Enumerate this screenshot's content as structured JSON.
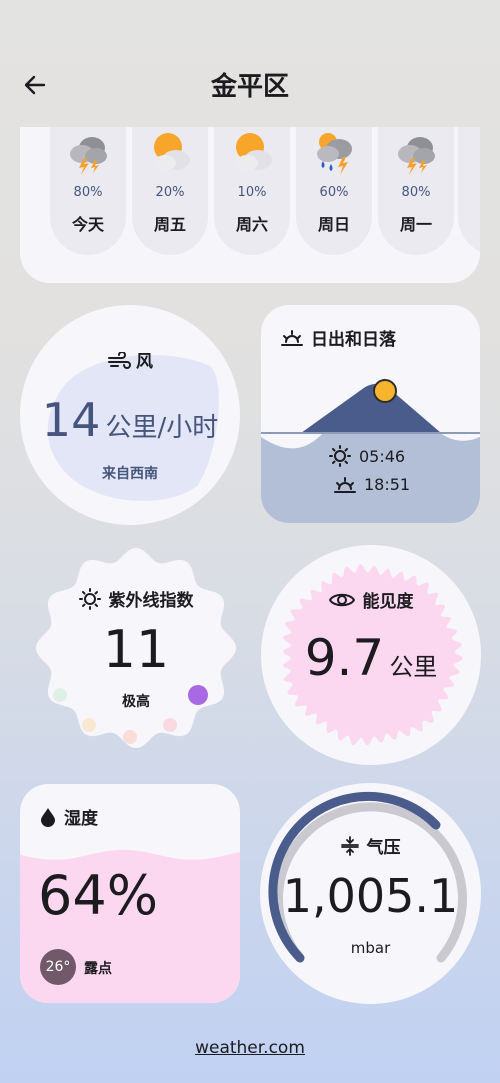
{
  "header": {
    "title": "金平区"
  },
  "forecast": [
    {
      "day": "今天",
      "precip": "80%",
      "icon": "thunderstorm-icon"
    },
    {
      "day": "周五",
      "precip": "20%",
      "icon": "partly-cloudy-icon"
    },
    {
      "day": "周六",
      "precip": "10%",
      "icon": "partly-cloudy-icon"
    },
    {
      "day": "周日",
      "precip": "60%",
      "icon": "rain-thunder-icon"
    },
    {
      "day": "周一",
      "precip": "80%",
      "icon": "thunderstorm-icon"
    }
  ],
  "wind": {
    "label": "风",
    "speed": "14",
    "unit": "公里/小时",
    "direction": "来自西南"
  },
  "sun": {
    "label": "日出和日落",
    "sunrise": "05:46",
    "sunset": "18:51"
  },
  "uv": {
    "label": "紫外线指数",
    "value": "11",
    "level": "极高"
  },
  "visibility": {
    "label": "能见度",
    "value": "9.7",
    "unit": "公里"
  },
  "humidity": {
    "label": "湿度",
    "value": "64%",
    "dew_point": "26°",
    "dew_label": "露点",
    "level": 0.64
  },
  "pressure": {
    "label": "气压",
    "value": "1,005.1",
    "unit": "mbar"
  },
  "footer": {
    "link": "weather.com"
  },
  "colors": {
    "accent": "#45557c",
    "pink": "#fcd8f0",
    "sun": "#f7b52d",
    "uv_active": "#a86ae2"
  }
}
